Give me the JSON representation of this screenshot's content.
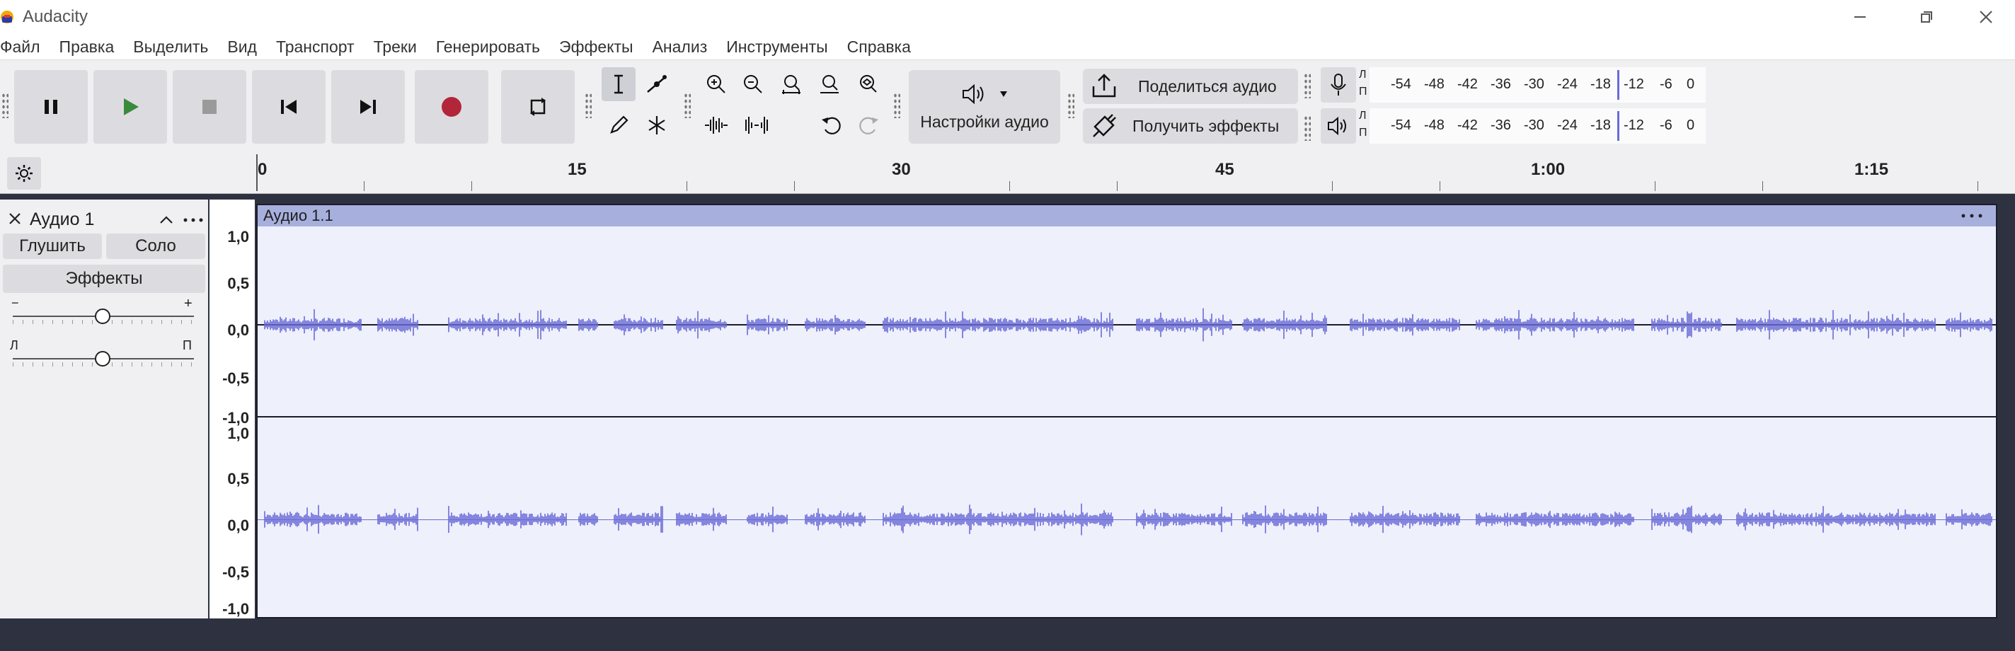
{
  "window": {
    "title": "Audacity",
    "colors": {
      "accent": "#6b6bd6",
      "clip_header": "#a7b0dd",
      "clip_bg": "#eef0fc",
      "record": "#b3263a",
      "play": "#3a8a3e"
    }
  },
  "menu": [
    "Файл",
    "Правка",
    "Выделить",
    "Вид",
    "Транспорт",
    "Треки",
    "Генерировать",
    "Эффекты",
    "Анализ",
    "Инструменты",
    "Справка"
  ],
  "toolbar": {
    "transport": [
      "pause-icon",
      "play-icon",
      "stop-icon",
      "skip-start-icon",
      "skip-end-icon",
      "record-icon",
      "loop-icon"
    ],
    "audio_setup_label": "Настройки аудио",
    "share_audio_label": "Поделиться аудио",
    "get_effects_label": "Получить эффекты",
    "meter_ticks": [
      "-54",
      "-48",
      "-42",
      "-36",
      "-30",
      "-24",
      "-18",
      "-12",
      "-6",
      "0"
    ],
    "meter_channels": {
      "left": "Л",
      "right": "П"
    }
  },
  "timeline": {
    "labels": [
      "0",
      "15",
      "30",
      "45",
      "1:00",
      "1:15"
    ]
  },
  "track": {
    "name": "Аудио 1",
    "mute_label": "Глушить",
    "solo_label": "Соло",
    "effects_label": "Эффекты",
    "gain_minus": "−",
    "gain_plus": "+",
    "pan_left": "Л",
    "pan_right": "П",
    "clip_name": "Аудио 1.1",
    "scale_labels": [
      "1,0",
      "0,5",
      "0,0",
      "-0,5",
      "-1,0"
    ]
  }
}
